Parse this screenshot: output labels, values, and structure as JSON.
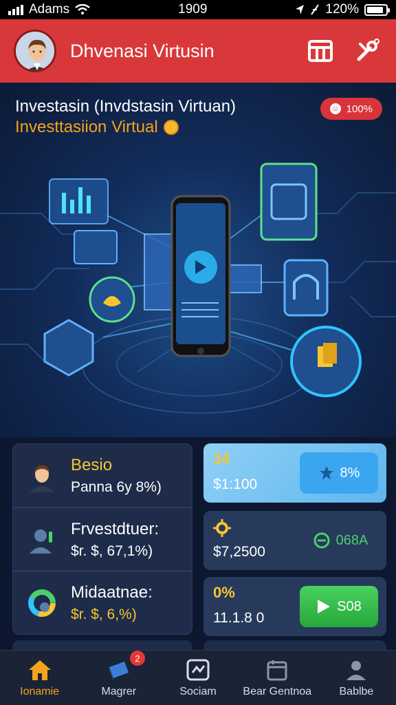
{
  "status_bar": {
    "carrier": "Adams",
    "time": "1909",
    "battery": "120%",
    "battery_level": 0.9
  },
  "app_bar": {
    "title": "Dhvenasi Virtusin",
    "actions": [
      "table-icon",
      "tools-icon"
    ]
  },
  "hero": {
    "line1": "Investasin (Invdstasin Virtuan)",
    "line2": "Investtasiion Virtual",
    "badge": "100%"
  },
  "left_panel": {
    "rows": [
      {
        "title": "Besio",
        "subtitle": "Panna 6y 8%)",
        "title_color": "#f7c531",
        "subtitle_color": "#ffffff",
        "icon": "person-avatar-icon"
      },
      {
        "title": "Frvestdtuer:",
        "subtitle": "$r. $, 67,1%)",
        "title_color": "#ffffff",
        "subtitle_color": "#ffffff",
        "icon": "user-silhouette-icon"
      },
      {
        "title": "Midaatnae:",
        "subtitle": "$r. $, 6,%)",
        "title_color": "#ffffff",
        "subtitle_color": "#f7c531",
        "icon": "donut-chart-icon"
      }
    ]
  },
  "right_cards": [
    {
      "top": "34",
      "value": "$1:100",
      "button": "8%",
      "button_icon": "star-icon"
    },
    {
      "top": "",
      "value": "$7,2500",
      "button": "068A",
      "button_icon": "coin-swap-icon"
    },
    {
      "top": "0%",
      "value": "11.1.8 0",
      "button": "S08",
      "button_icon": "play-icon"
    }
  ],
  "bottom_nav": [
    {
      "label": "Ionamie",
      "icon": "home-icon",
      "active": true
    },
    {
      "label": "Magrer",
      "icon": "book-icon",
      "badge": "2"
    },
    {
      "label": "Sociam",
      "icon": "chart-square-icon"
    },
    {
      "label": "Bear Gentnoa",
      "icon": "calendar-icon"
    },
    {
      "label": "Bablbe",
      "icon": "profile-icon"
    }
  ],
  "colors": {
    "app_bar": "#d9383a",
    "accent": "#f5a21e",
    "card_bg": "#1e2c4a",
    "green_button": "#2fb84a",
    "blue_button": "#3ba6f0"
  }
}
